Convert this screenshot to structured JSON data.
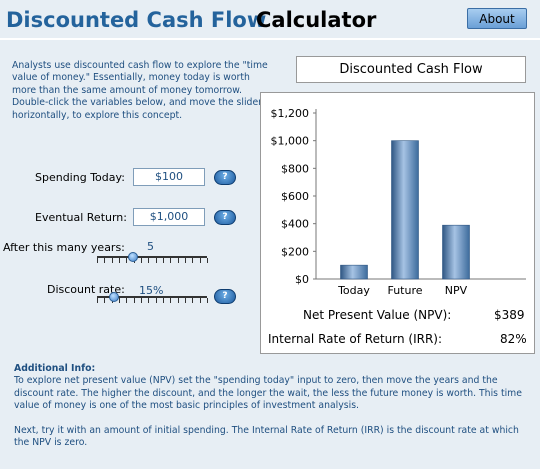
{
  "header": {
    "title_part1": "Discounted Cash Flow",
    "title_part2": "Calculator",
    "about_label": "About"
  },
  "intro_text": "Analysts use discounted cash flow to explore the \"time value of money.\"  Essentially, money today is worth more than the same amount of money tomorrow.  Double-click the variables below, and move the sliders horizontally, to explore this concept.",
  "inputs": {
    "spending_label": "Spending Today:",
    "spending_value": "$100",
    "return_label": "Eventual Return:",
    "return_value": "$1,000",
    "years_label": "After this many years:",
    "years_value": "5",
    "years_level": 0.33,
    "rate_label": "Discount rate:",
    "rate_value": "15%",
    "rate_level": 0.15,
    "help_label": "?"
  },
  "chart_data": {
    "type": "bar",
    "title": "Discounted Cash Flow",
    "categories": [
      "Today",
      "Future",
      "NPV"
    ],
    "values": [
      100,
      1000,
      389
    ],
    "ylim": [
      0,
      1200
    ],
    "yticks": [
      "$0",
      "$200",
      "$400",
      "$600",
      "$800",
      "$1,000",
      "$1,200"
    ],
    "bar_color": "#3d6b9c"
  },
  "results": {
    "npv_label": "Net Present Value (NPV):",
    "npv_value": "$389",
    "irr_label": "Internal Rate of Return (IRR):",
    "irr_value": "82%"
  },
  "info": {
    "heading": "Additional Info:",
    "para1": "To explore net present value (NPV) set the \"spending today\" input to zero, then move the years and the discount rate.  The higher the discount, and the longer the wait, the less the future money is worth.  This time value of money is one of the most basic principles of investment analysis.",
    "para2": "Next, try it with an amount of initial spending. The Internal Rate of Return (IRR) is the discount rate at which the NPV is zero."
  },
  "colors": {
    "title_blue": "#24639c",
    "text_blue": "#1f4f80",
    "background": "#e7eef4"
  }
}
